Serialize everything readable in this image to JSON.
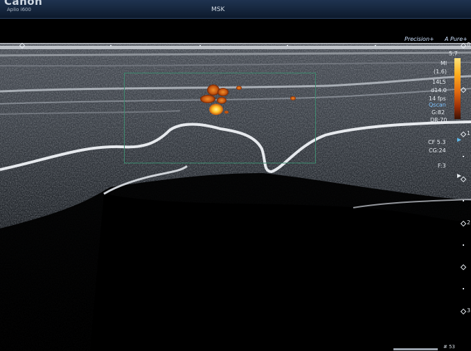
{
  "header": {
    "brand": "Canon",
    "model": "Aplio i600",
    "exam": "MSK"
  },
  "presets": {
    "precision": "Precision+",
    "apure": "A Pure+"
  },
  "readouts": {
    "scale_max": "5.7",
    "mi_label": "MI",
    "mi_value": "(1.6)",
    "probe": "14L5",
    "freq": "d14.0",
    "frame_rate": "14 fps",
    "qscan": "Qscan",
    "gain": "G:82",
    "dynamic_range": "DR:70",
    "color_freq": "CF 5.3",
    "color_gain": "CG:24",
    "focus": "F:3"
  },
  "depth_scale": [
    "0",
    "1",
    "2",
    "3"
  ],
  "footer": {
    "text": "# 53"
  },
  "colors": {
    "roi_box": "#3e8a6f",
    "doppler_hot": "#ffcf3a",
    "doppler_warm": "#d8641a",
    "header_bg": "#14253d",
    "accent_blue": "#7fc4ff"
  },
  "icons": [
    "focus-marker-icon",
    "depth-marker-icon"
  ]
}
